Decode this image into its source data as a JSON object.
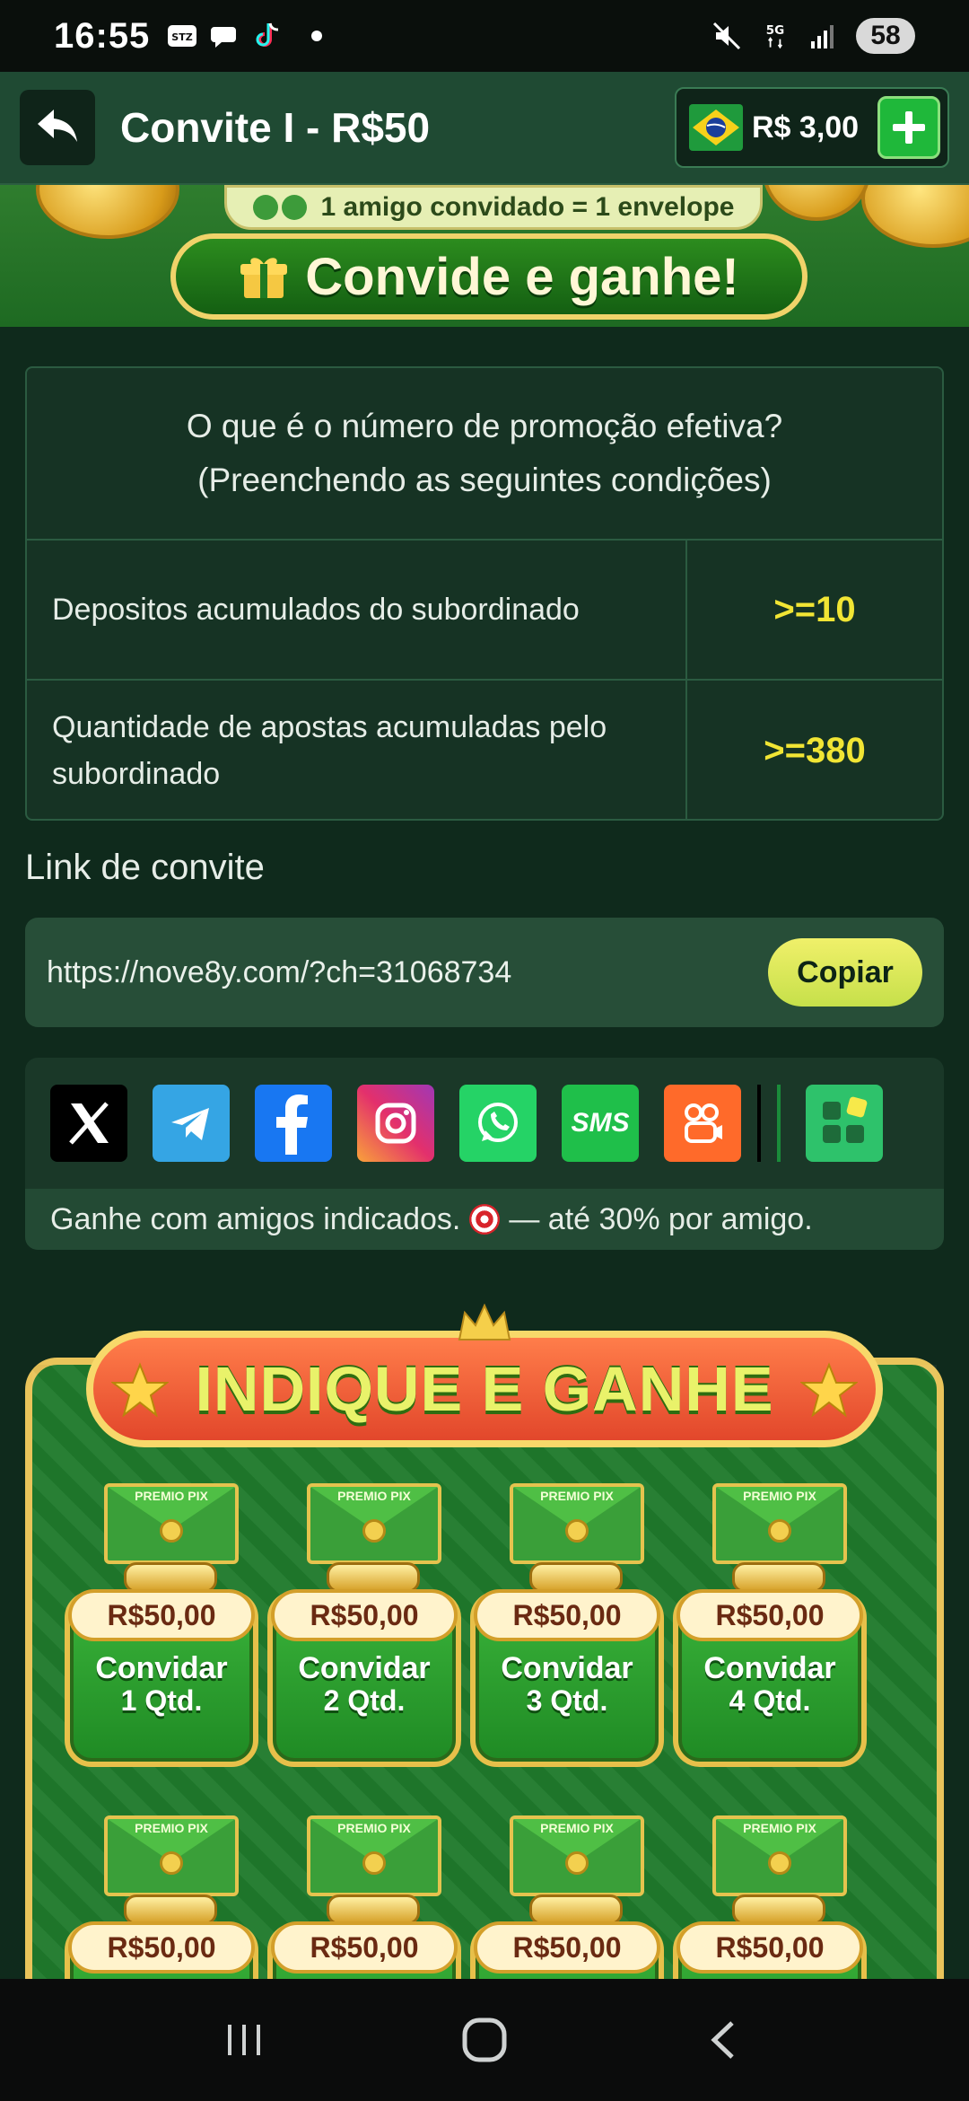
{
  "status_bar": {
    "time": "16:55",
    "battery": "58",
    "network": "5G",
    "app_badge": "STZ"
  },
  "header": {
    "title": "Convite I - R$50",
    "balance": "R$ 3,00"
  },
  "banner": {
    "pill_text": "1 amigo convidado = 1 envelope",
    "cta": "Convide e ganhe!"
  },
  "conditions": {
    "heading_line1": "O que é o número de promoção efetiva?",
    "heading_line2": "(Preenchendo as seguintes condições)",
    "rows": [
      {
        "label": "Depositos acumulados do subordinado",
        "value": ">=10"
      },
      {
        "label": "Quantidade de apostas acumuladas pelo subordinado",
        "value": ">=380"
      }
    ]
  },
  "invite_link": {
    "section_label": "Link de convite",
    "url": "https://nove8y.com/?ch=31068734",
    "copy_label": "Copiar"
  },
  "share": {
    "icons": [
      "x-icon",
      "telegram-icon",
      "facebook-icon",
      "instagram-icon",
      "whatsapp-icon",
      "sms-icon",
      "kwai-icon",
      "more-apps-icon"
    ],
    "sms_label": "SMS",
    "note_before": "Ganhe com amigos indicados.",
    "note_after": "— até 30% por amigo."
  },
  "promo": {
    "title": "INDIQUE E GANHE",
    "envelope_label": "PREMIO PIX",
    "cards": [
      {
        "price": "R$50,00",
        "action": "Convidar",
        "qty": "1 Qtd."
      },
      {
        "price": "R$50,00",
        "action": "Convidar",
        "qty": "2 Qtd."
      },
      {
        "price": "R$50,00",
        "action": "Convidar",
        "qty": "3 Qtd."
      },
      {
        "price": "R$50,00",
        "action": "Convidar",
        "qty": "4 Qtd."
      },
      {
        "price": "R$50,00"
      },
      {
        "price": "R$50,00"
      },
      {
        "price": "R$50,00"
      },
      {
        "price": "R$50,00"
      }
    ]
  },
  "colors": {
    "background": "#0f2a1c",
    "header": "#1f4a33",
    "accent_yellow": "#f1e534",
    "accent_green": "#1fb83a"
  }
}
